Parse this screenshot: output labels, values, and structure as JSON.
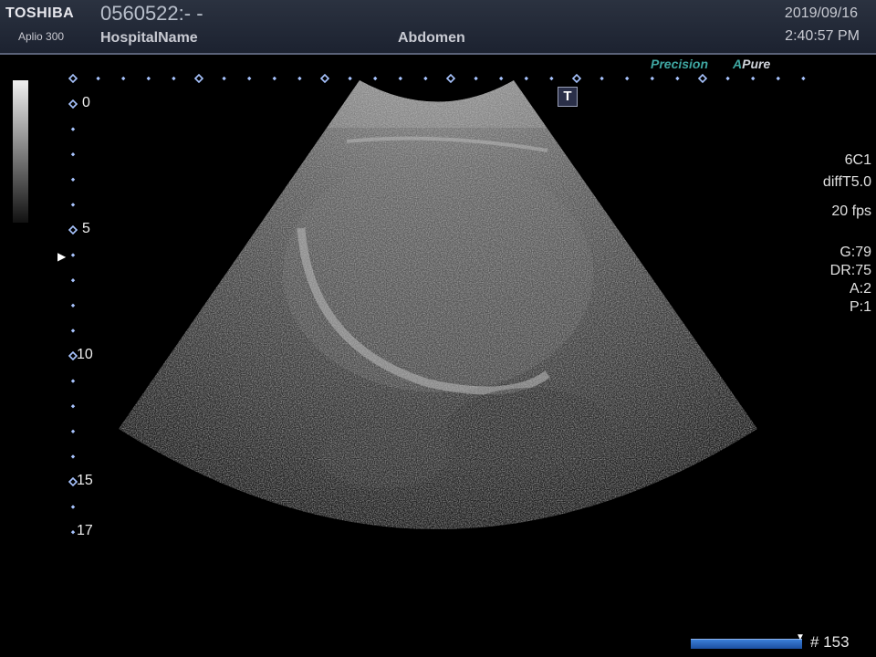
{
  "header": {
    "brand": "TOSHIBA",
    "model": "Aplio 300",
    "patient_id": "0560522:- -",
    "hospital": "HospitalName",
    "exam": "Abdomen",
    "date": "2019/09/16",
    "time": "2:40:57 PM"
  },
  "image_mode": {
    "precision_label": "Precision",
    "apure_a": "A",
    "apure_label": "Pure",
    "tgc_label": "T"
  },
  "settings": {
    "probe": "6C1",
    "preset": "diffT5.0",
    "fps": "20 fps",
    "gain": "G:79",
    "dynamic_range": "DR:75",
    "a": "A:2",
    "p": "P:1"
  },
  "depth_scale": {
    "labels": [
      "0",
      "5",
      "10",
      "15",
      "17"
    ],
    "unit_max": 17
  },
  "cine": {
    "frame": "# 153"
  },
  "colors": {
    "accent_teal": "#3fa7a2",
    "scale_marker": "#a8c4ff",
    "cine_bar": "#2e6ec4",
    "header_bg": "#232a38"
  },
  "icons": [
    "tgc-icon",
    "depth-marker-icon",
    "cine-position-icon"
  ]
}
